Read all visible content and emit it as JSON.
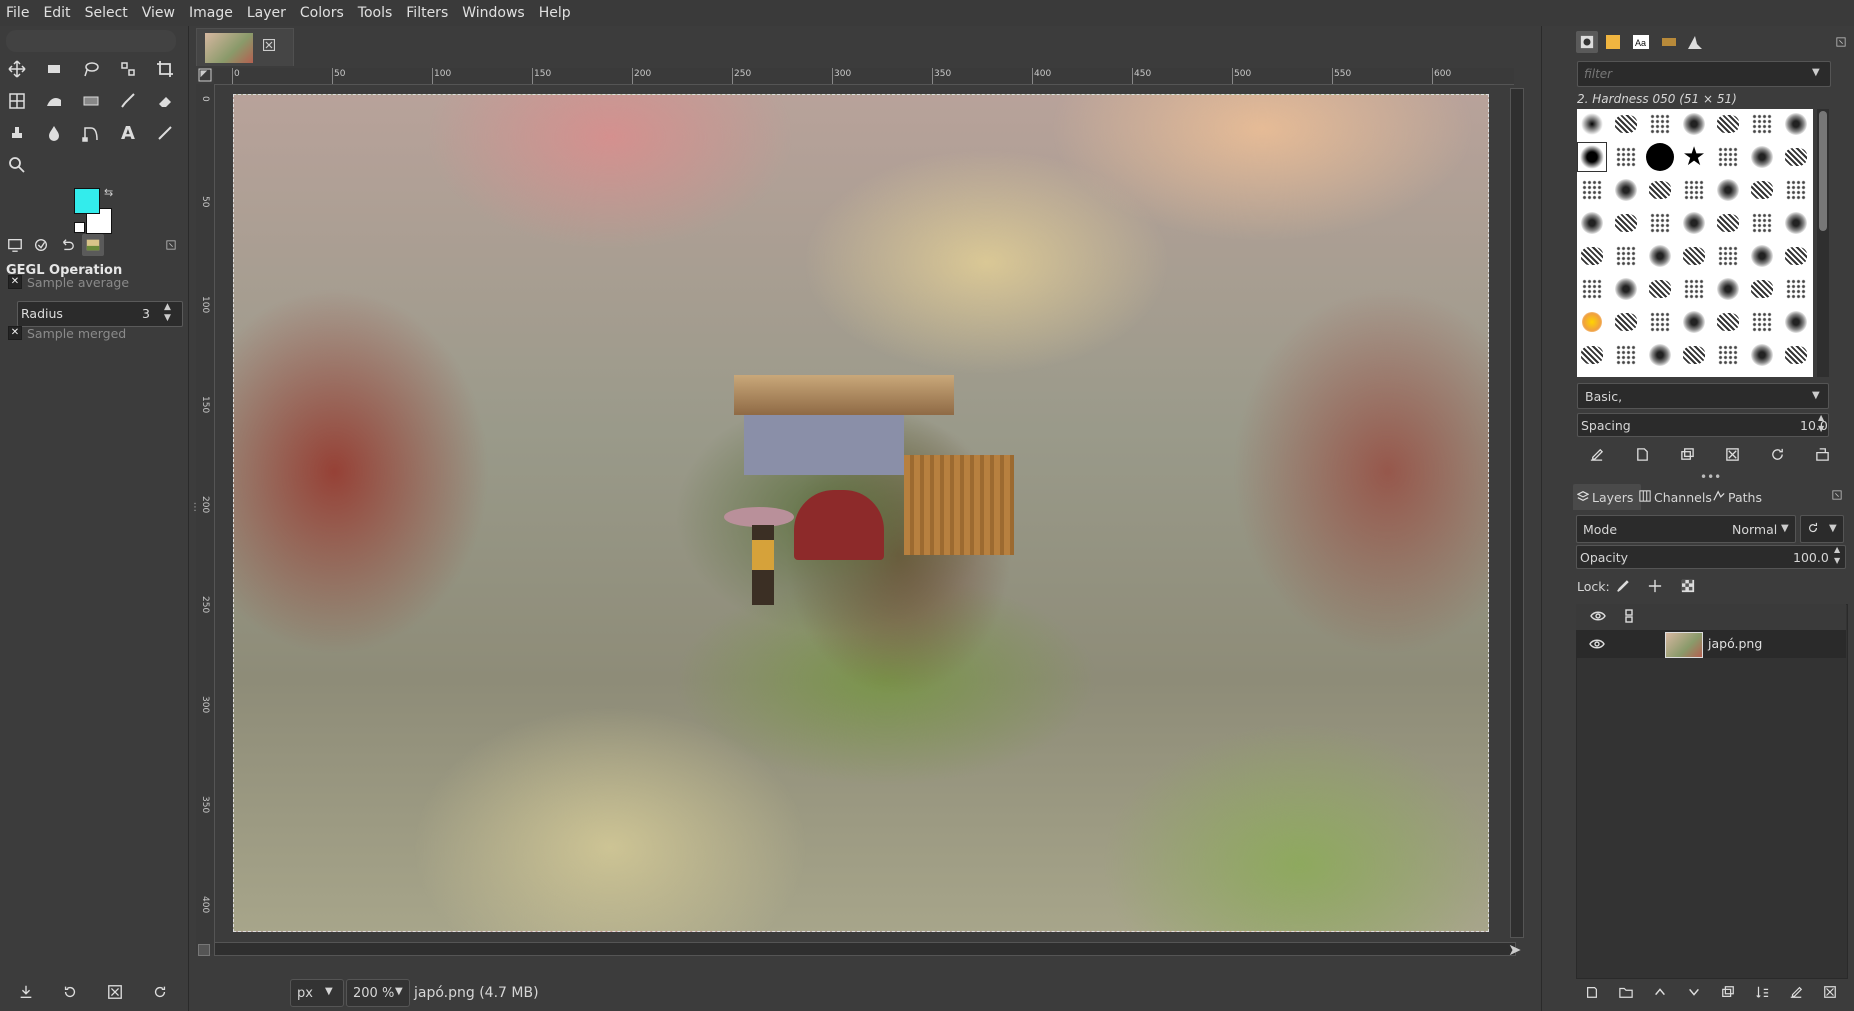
{
  "menubar": [
    "File",
    "Edit",
    "Select",
    "View",
    "Image",
    "Layer",
    "Colors",
    "Tools",
    "Filters",
    "Windows",
    "Help"
  ],
  "toolbox": {
    "tools": [
      {
        "name": "move-tool-icon"
      },
      {
        "name": "rect-select-icon"
      },
      {
        "name": "lasso-icon"
      },
      {
        "name": "fuzzy-select-icon"
      },
      {
        "name": "crop-icon"
      },
      {
        "name": "unified-transform-icon"
      },
      {
        "name": "warp-icon"
      },
      {
        "name": "gradient-icon"
      },
      {
        "name": "paintbrush-icon"
      },
      {
        "name": "eraser-icon"
      },
      {
        "name": "clone-icon"
      },
      {
        "name": "smudge-icon"
      },
      {
        "name": "paths-icon"
      },
      {
        "name": "text-icon"
      },
      {
        "name": "color-picker-icon"
      },
      {
        "name": "zoom-icon"
      }
    ],
    "fg_color": "#33ecec",
    "bg_color": "#ffffff"
  },
  "tool_options": {
    "title": "GEGL Operation",
    "sample_average": "Sample average",
    "radius_label": "Radius",
    "radius_value": "3",
    "sample_merged": "Sample merged"
  },
  "canvas": {
    "ruler_top": [
      "0",
      "50",
      "100",
      "150",
      "200",
      "250",
      "300",
      "350",
      "400",
      "450",
      "500",
      "550",
      "600"
    ],
    "ruler_left": [
      "0",
      "50",
      "100",
      "150",
      "200",
      "250",
      "300",
      "350",
      "400"
    ]
  },
  "statusbar": {
    "unit": "px",
    "zoom": "200 %",
    "file_info": "japó.png (4.7 MB)"
  },
  "brushes": {
    "filter_placeholder": "filter",
    "selected_name": "2. Hardness 050 (51 × 51)",
    "tag": "Basic,",
    "spacing_label": "Spacing",
    "spacing_value": "10.0"
  },
  "layers": {
    "tabs": [
      "Layers",
      "Channels",
      "Paths"
    ],
    "mode_label": "Mode",
    "mode_value": "Normal",
    "opacity_label": "Opacity",
    "opacity_value": "100.0",
    "lock_label": "Lock:",
    "items": [
      {
        "name": "japó.png"
      }
    ]
  }
}
